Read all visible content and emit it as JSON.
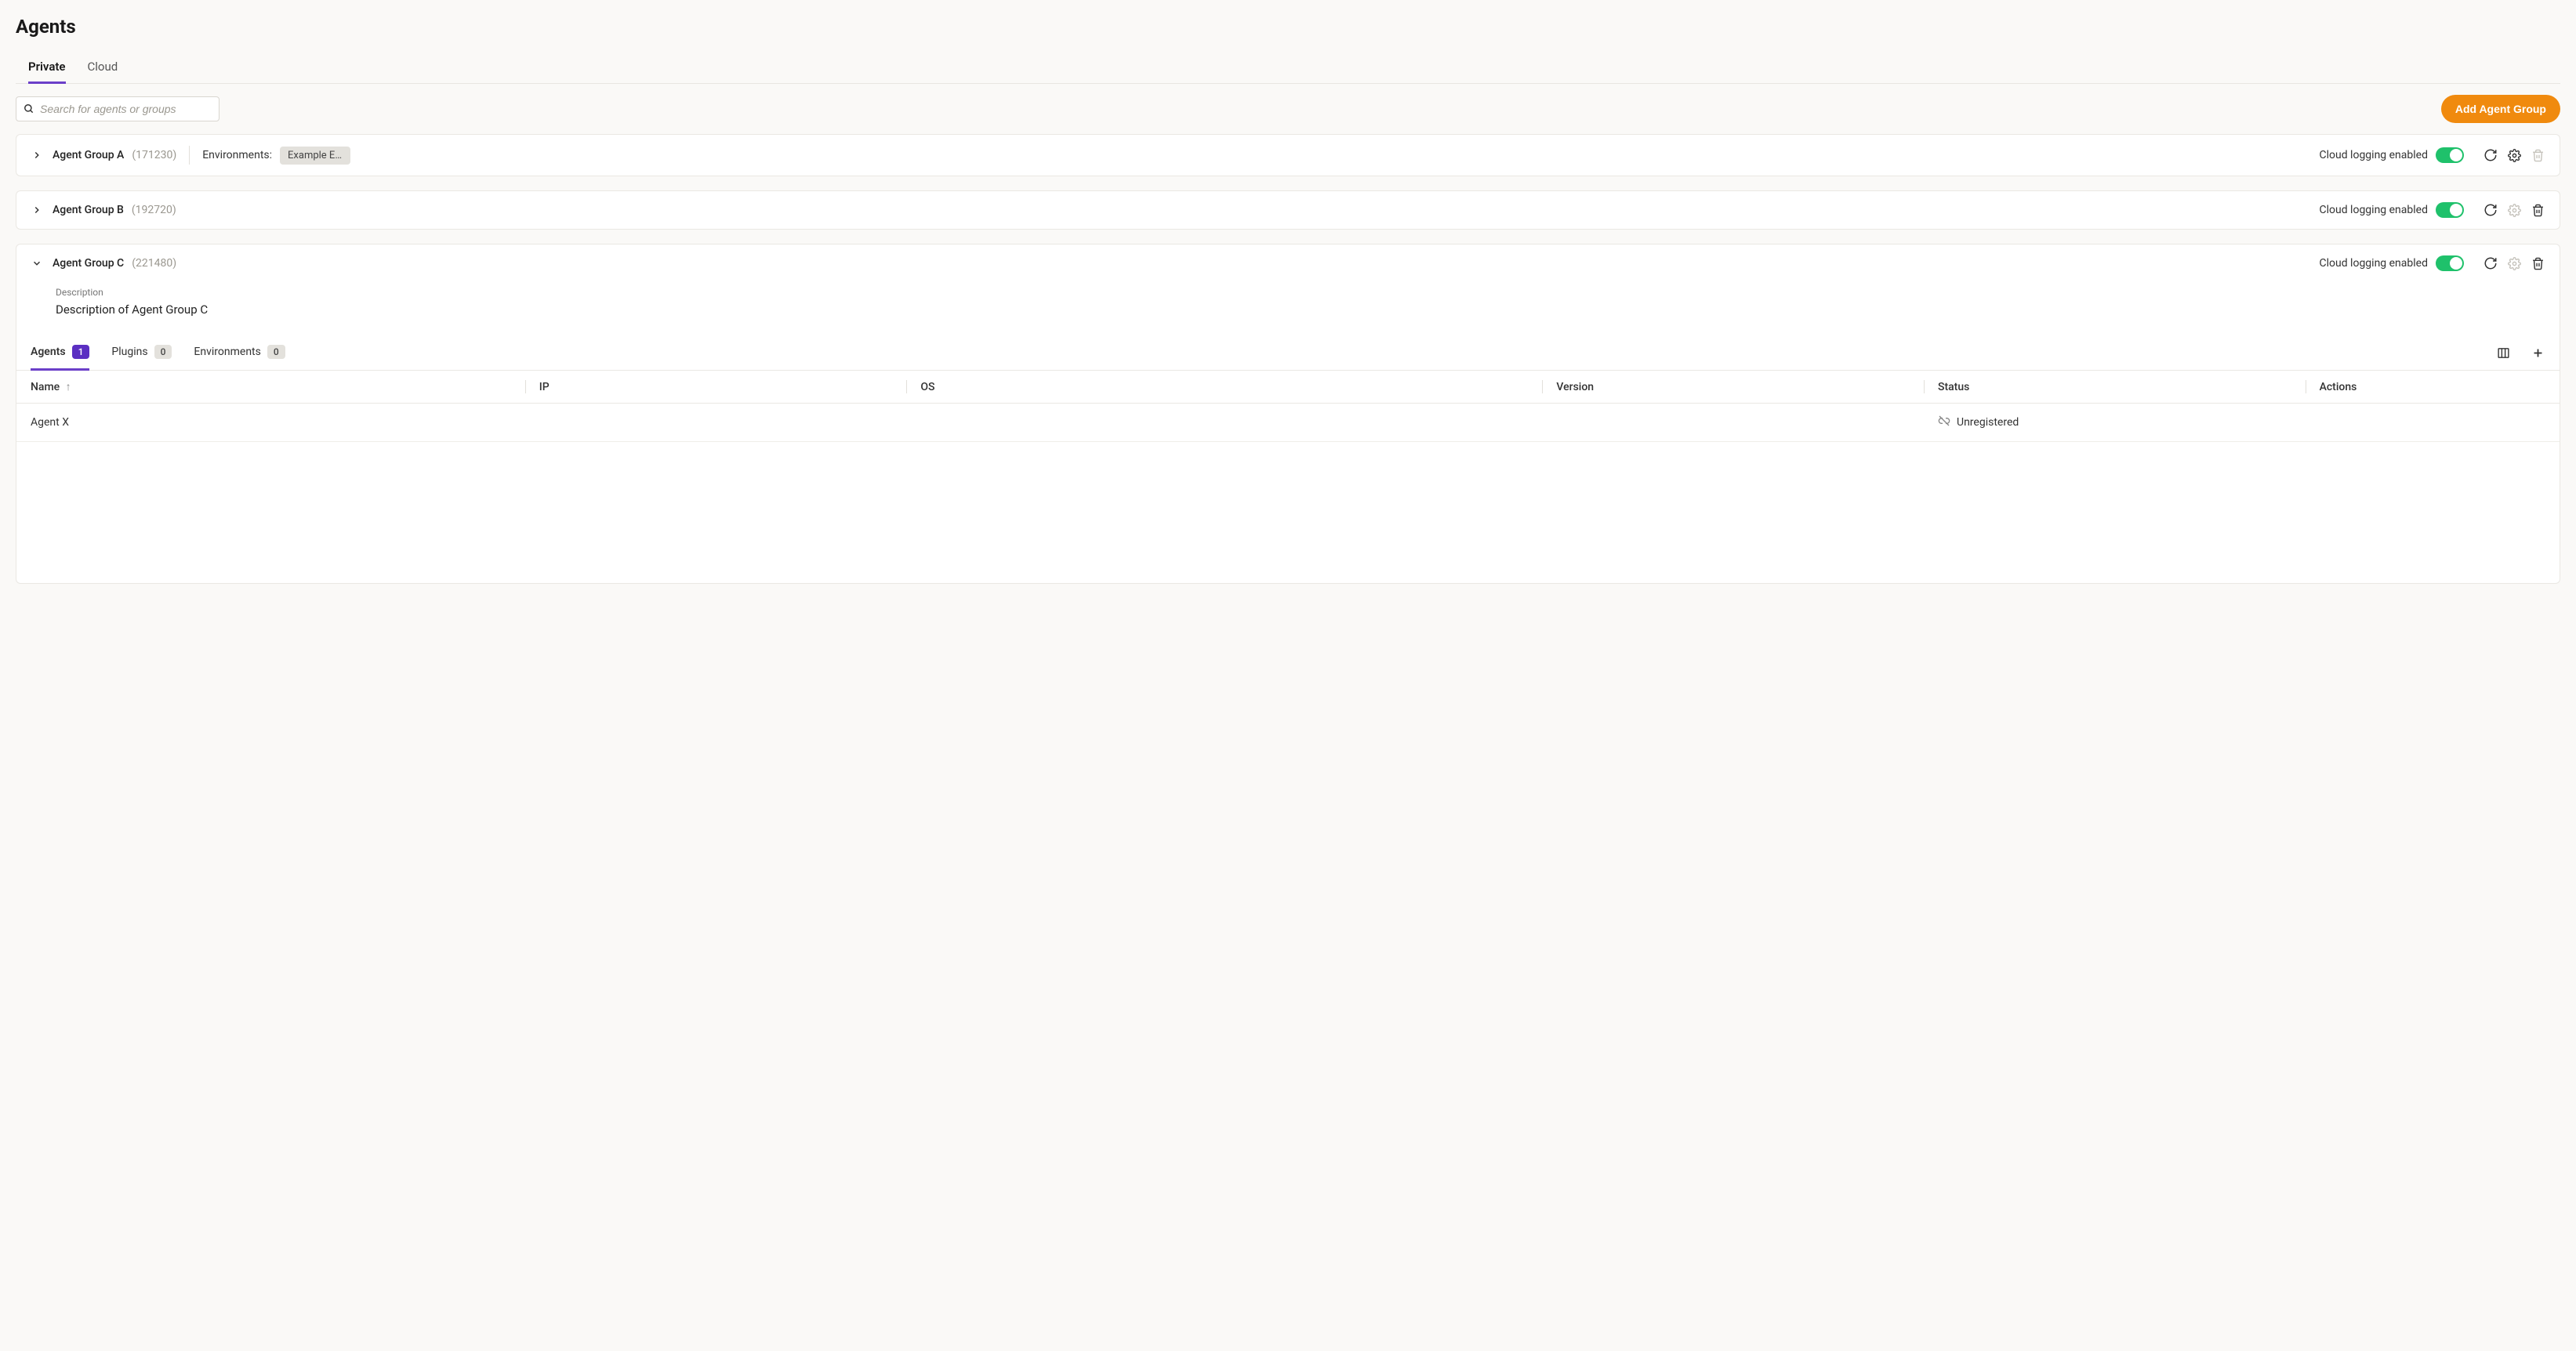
{
  "page_title": "Agents",
  "tabs": {
    "private": "Private",
    "cloud": "Cloud"
  },
  "search": {
    "placeholder": "Search for agents or groups"
  },
  "add_button": "Add Agent Group",
  "cloud_logging_label": "Cloud logging enabled",
  "groups": [
    {
      "name": "Agent Group A",
      "id": "(171230)",
      "environments_label": "Environments:",
      "environments": [
        "Example Env…"
      ],
      "expanded": false,
      "gear_enabled": true,
      "trash_enabled": false
    },
    {
      "name": "Agent Group B",
      "id": "(192720)",
      "expanded": false,
      "gear_enabled": false,
      "trash_enabled": true
    },
    {
      "name": "Agent Group C",
      "id": "(221480)",
      "expanded": true,
      "gear_enabled": false,
      "trash_enabled": true,
      "description_label": "Description",
      "description": "Description of Agent Group C"
    }
  ],
  "inner_tabs": {
    "agents": {
      "label": "Agents",
      "count": "1"
    },
    "plugins": {
      "label": "Plugins",
      "count": "0"
    },
    "environments": {
      "label": "Environments",
      "count": "0"
    }
  },
  "table": {
    "headers": {
      "name": "Name",
      "ip": "IP",
      "os": "OS",
      "version": "Version",
      "status": "Status",
      "actions": "Actions"
    },
    "rows": [
      {
        "name": "Agent X",
        "ip": "",
        "os": "",
        "version": "",
        "status": "Unregistered"
      }
    ]
  }
}
